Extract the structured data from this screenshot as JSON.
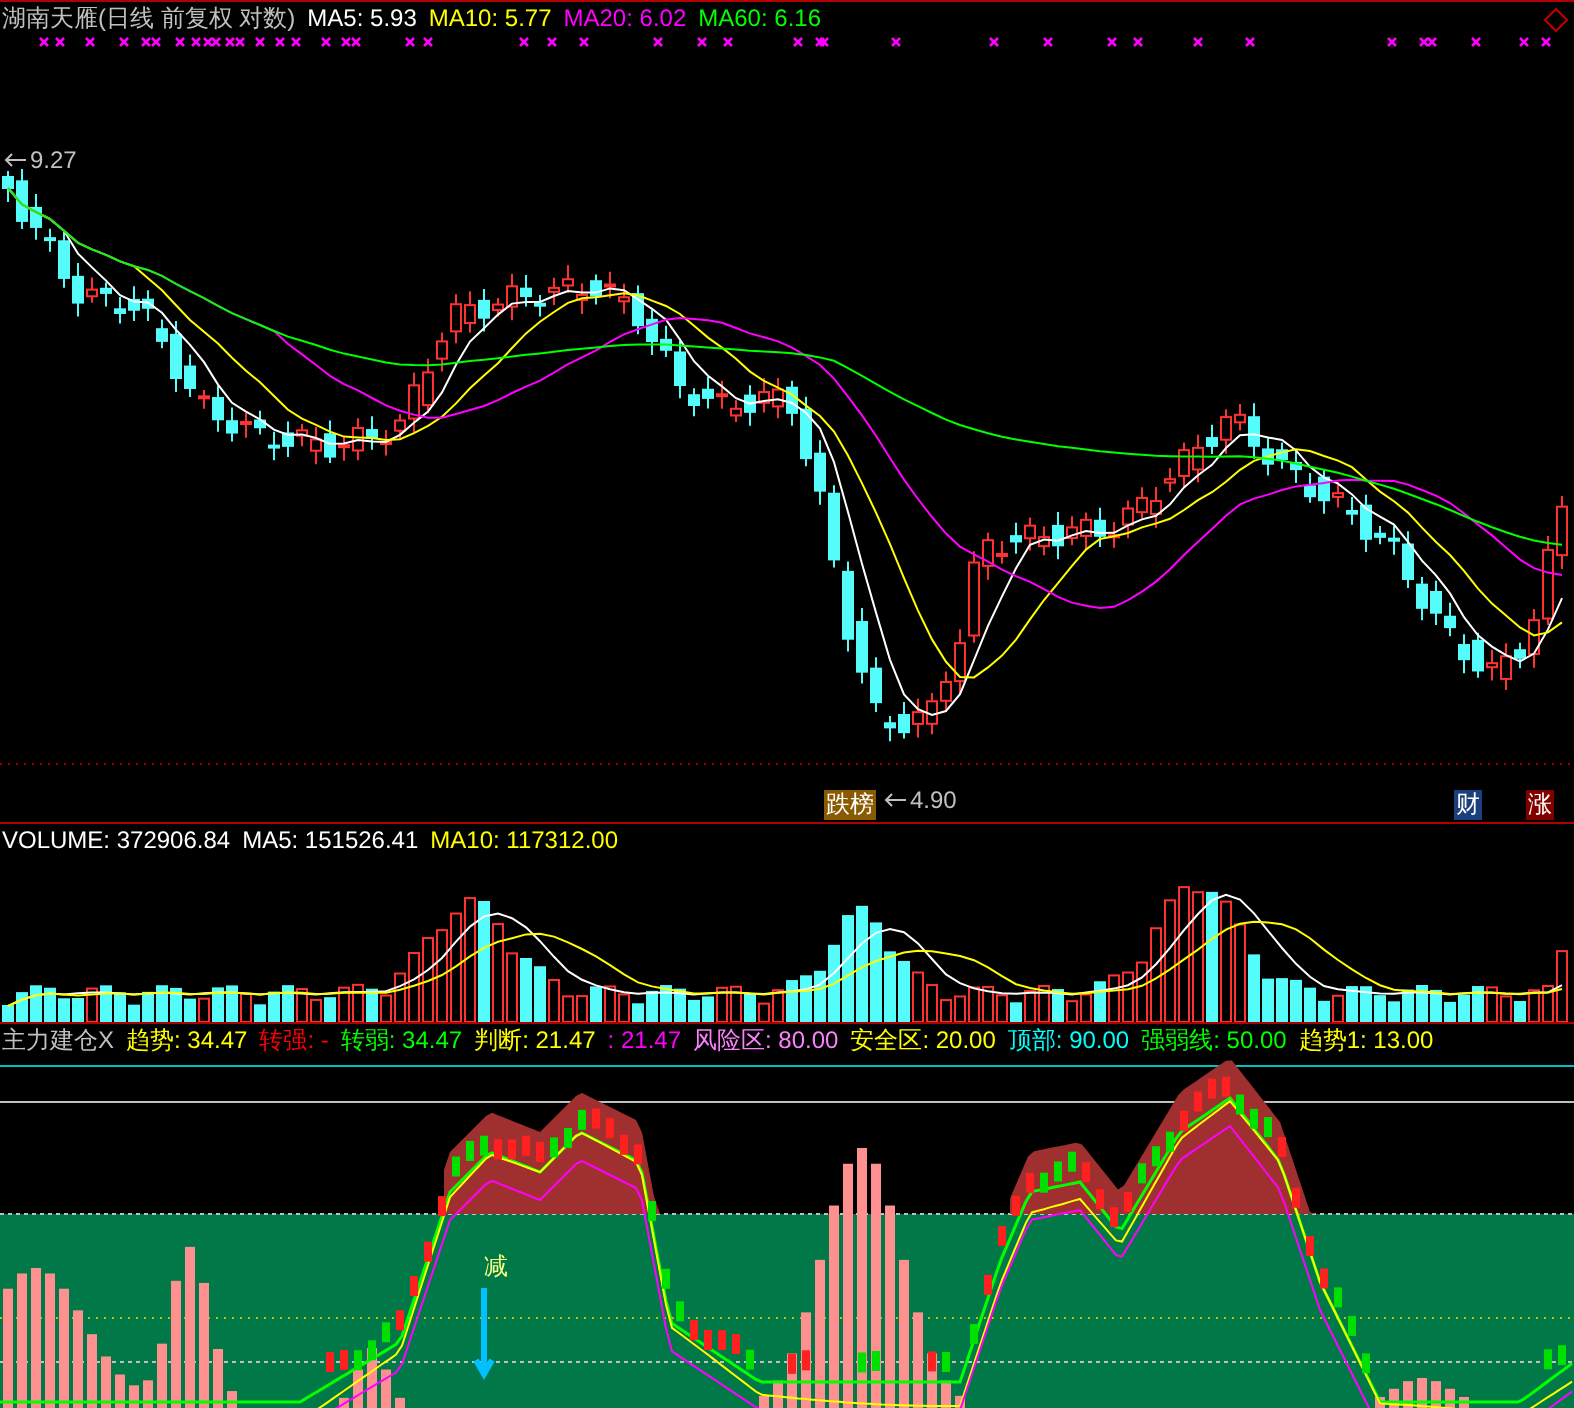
{
  "main_panel": {
    "title": "湖南天雁(日线 前复权 对数)",
    "indicators": [
      {
        "label": "MA5: 5.93",
        "color": "#ffffff"
      },
      {
        "label": "MA10: 5.77",
        "color": "#ffff00"
      },
      {
        "label": "MA20: 6.02",
        "color": "#ff00ff"
      },
      {
        "label": "MA60: 6.16",
        "color": "#00ff00"
      }
    ],
    "high_label": "9.27",
    "low_label": "4.90",
    "tags": [
      {
        "text": "跌榜",
        "color": "#8a5a00"
      },
      {
        "text": "财",
        "color": "#1a3f7a"
      },
      {
        "text": "涨",
        "color": "#800000"
      }
    ]
  },
  "volume_panel": {
    "indicators": [
      {
        "label": "VOLUME: 372906.84",
        "color": "#ffffff"
      },
      {
        "label": "MA5: 151526.41",
        "color": "#ffffff"
      },
      {
        "label": "MA10: 117312.00",
        "color": "#ffff00"
      }
    ]
  },
  "indicator_panel": {
    "title": "主力建仓X",
    "indicators": [
      {
        "label": "趋势: 34.47",
        "color": "#ffff00"
      },
      {
        "label": "转强: -",
        "color": "#ff0000"
      },
      {
        "label": "转弱: 34.47",
        "color": "#00ff00"
      },
      {
        "label": "判断: 21.47",
        "color": "#ffff00"
      },
      {
        "label": ": 21.47",
        "color": "#ff00ff"
      },
      {
        "label": "风险区: 80.00",
        "color": "#ff80ff"
      },
      {
        "label": "安全区: 20.00",
        "color": "#ffff00"
      },
      {
        "label": "顶部: 90.00",
        "color": "#00ffff"
      },
      {
        "label": "强弱线: 50.00",
        "color": "#00ff00"
      },
      {
        "label": "趋势1: 13.00",
        "color": "#ffff00"
      }
    ],
    "signal_label": "减"
  }
}
